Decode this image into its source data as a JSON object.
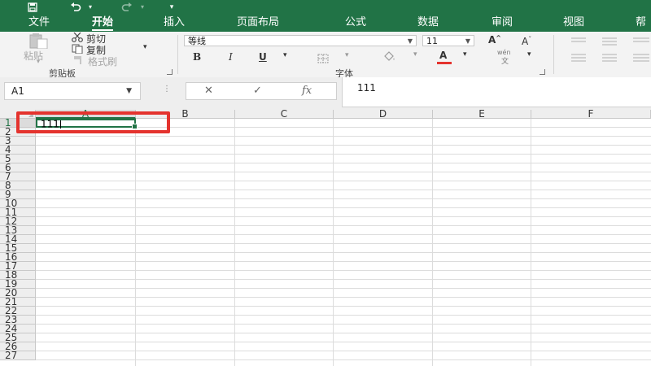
{
  "quick_access": {
    "save_icon": "save-icon",
    "undo_icon": "undo-icon",
    "redo_icon": "redo-icon",
    "customize_icon": "customize-qat-icon"
  },
  "tabs": [
    {
      "label": "文件"
    },
    {
      "label": "开始"
    },
    {
      "label": "插入"
    },
    {
      "label": "页面布局"
    },
    {
      "label": "公式"
    },
    {
      "label": "数据"
    },
    {
      "label": "审阅"
    },
    {
      "label": "视图"
    },
    {
      "label": "帮"
    }
  ],
  "active_tab": "开始",
  "ribbon": {
    "clipboard": {
      "paste_label": "粘贴",
      "cut_label": "剪切",
      "copy_label": "复制",
      "format_painter_label": "格式刷",
      "group_label": "剪贴板"
    },
    "font": {
      "font_name": "等线",
      "font_size": "11",
      "bold": "B",
      "italic": "I",
      "underline": "U",
      "increase_size": "A",
      "decrease_size": "A",
      "font_color": "A",
      "phonetic": "wén",
      "group_label": "字体"
    }
  },
  "formula_bar": {
    "name_box": "A1",
    "cancel_symbol": "✕",
    "enter_symbol": "✓",
    "fx_symbol": "fx",
    "content": "111"
  },
  "sheet": {
    "columns": [
      "A",
      "B",
      "C",
      "D",
      "E",
      "F"
    ],
    "rows": [
      "1",
      "2",
      "3",
      "4",
      "5",
      "6",
      "7",
      "8",
      "9",
      "10",
      "11",
      "12",
      "13",
      "14",
      "15",
      "16",
      "17",
      "18",
      "19",
      "20",
      "21",
      "22",
      "23",
      "24",
      "25",
      "26",
      "27"
    ],
    "active_cell": "A1",
    "active_cell_value": "111"
  },
  "colors": {
    "brand_green": "#217346",
    "highlight_red": "#e4332e"
  }
}
